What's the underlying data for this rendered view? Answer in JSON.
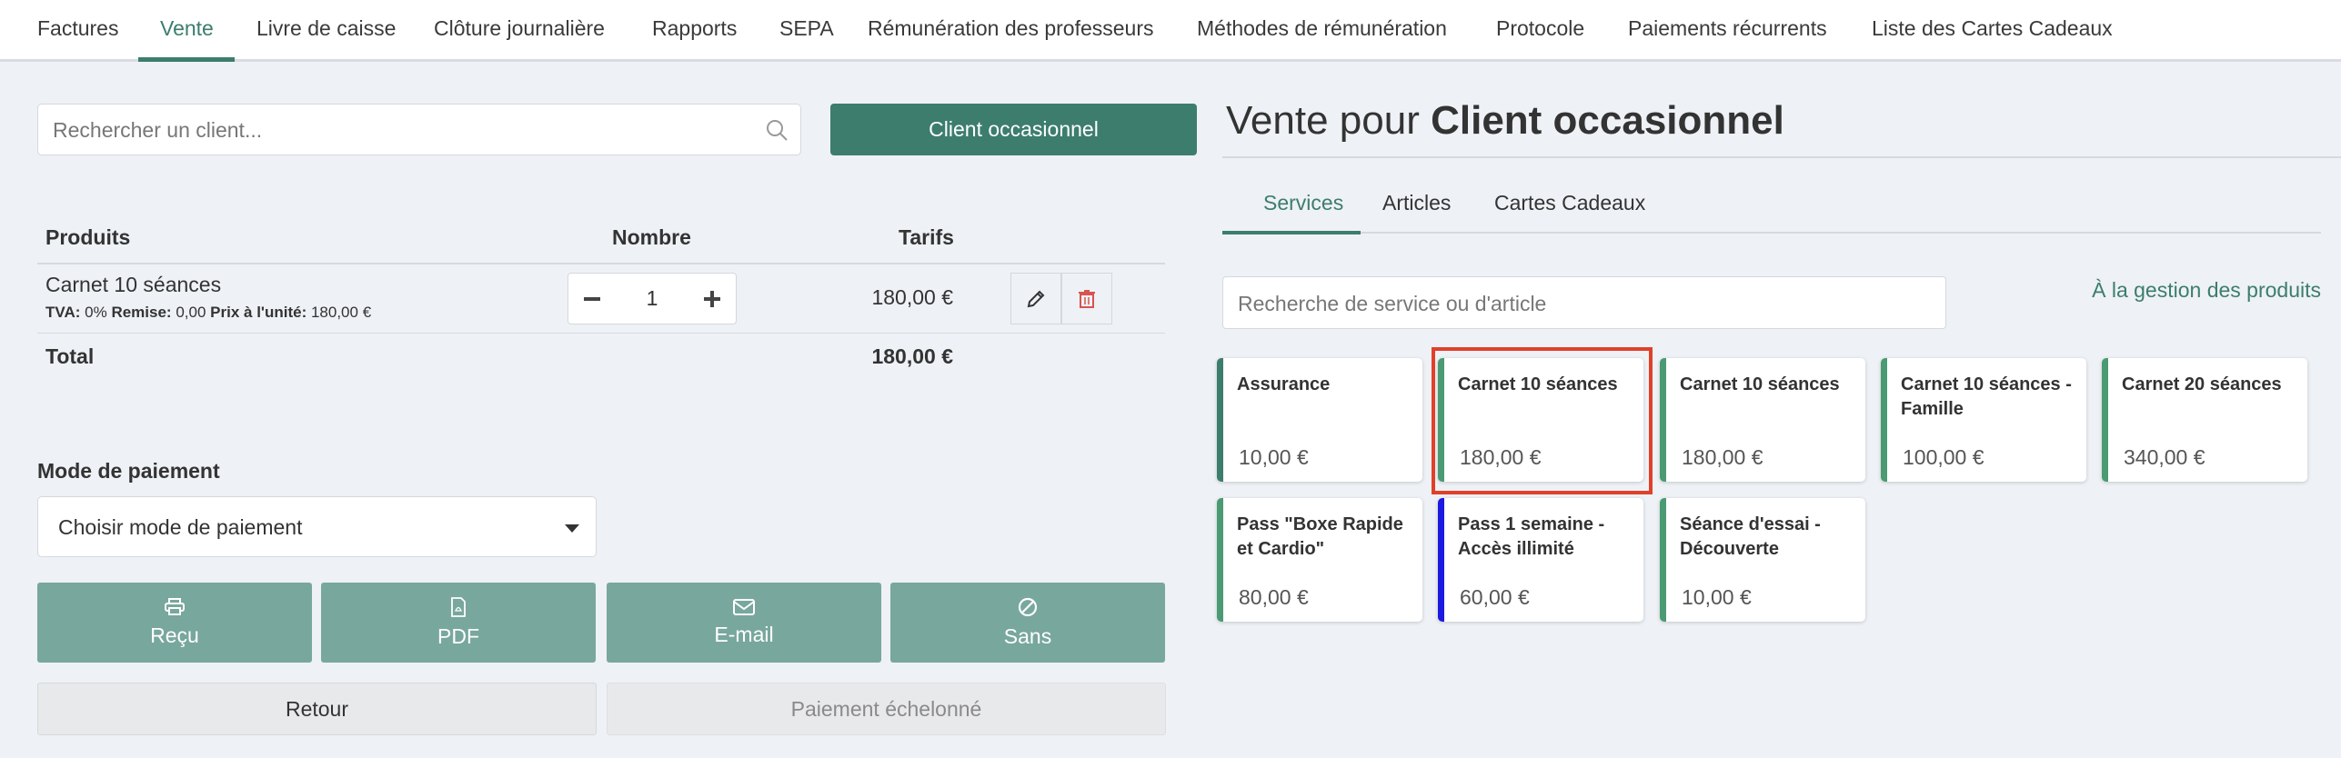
{
  "nav": {
    "tabs": [
      {
        "label": "Factures"
      },
      {
        "label": "Vente"
      },
      {
        "label": "Livre de caisse"
      },
      {
        "label": "Clôture journalière"
      },
      {
        "label": "Rapports"
      },
      {
        "label": "SEPA"
      },
      {
        "label": "Rémunération des professeurs"
      },
      {
        "label": "Méthodes de rémunération"
      },
      {
        "label": "Protocole"
      },
      {
        "label": "Paiements récurrents"
      },
      {
        "label": "Liste des Cartes Cadeaux"
      }
    ],
    "active": "Vente"
  },
  "client": {
    "search_placeholder": "Rechercher un client...",
    "occasional_button": "Client occasionnel"
  },
  "cart": {
    "headers": {
      "products": "Produits",
      "quantity": "Nombre",
      "price": "Tarifs"
    },
    "items": [
      {
        "name": "Carnet 10 séances",
        "vat_label": "TVA:",
        "vat": "0%",
        "discount_label": "Remise:",
        "discount": "0,00",
        "unit_label": "Prix à l'unité:",
        "unit_price": "180,00 €",
        "quantity": "1",
        "price": "180,00 €"
      }
    ],
    "total_label": "Total",
    "total": "180,00 €"
  },
  "payment": {
    "label": "Mode de paiement",
    "select_value": "Choisir mode de paiement",
    "actions": [
      {
        "label": "Reçu",
        "icon": "printer-icon"
      },
      {
        "label": "PDF",
        "icon": "pdf-file-icon"
      },
      {
        "label": "E-mail",
        "icon": "envelope-icon"
      },
      {
        "label": "Sans",
        "icon": "ban-icon"
      }
    ],
    "back_button": "Retour",
    "installment_button": "Paiement échelonné"
  },
  "sale": {
    "title_prefix": "Vente pour",
    "title_client": "Client occasionnel",
    "tabs": [
      {
        "label": "Services"
      },
      {
        "label": "Articles"
      },
      {
        "label": "Cartes Cadeaux"
      }
    ],
    "active_tab": "Services",
    "search_placeholder": "Recherche de service ou d'article",
    "manage_link": "À la gestion des produits",
    "products": [
      {
        "name": "Assurance",
        "price": "10,00 €",
        "color": "#3c7d6e"
      },
      {
        "name": "Carnet 10 séances",
        "price": "180,00 €",
        "color": "#4a9a73",
        "highlighted": true
      },
      {
        "name": "Carnet 10 séances",
        "price": "180,00 €",
        "color": "#4a9a73"
      },
      {
        "name": "Carnet 10 séances - Famille",
        "price": "100,00 €",
        "color": "#4a9a73"
      },
      {
        "name": "Carnet 20 séances",
        "price": "340,00 €",
        "color": "#4a9a73"
      },
      {
        "name": "Pass \"Boxe Rapide et Cardio\"",
        "price": "80,00 €",
        "color": "#4a9a73"
      },
      {
        "name": "Pass 1 semaine - Accès illimité",
        "price": "60,00 €",
        "color": "#1a1ae0"
      },
      {
        "name": "Séance d'essai - Découverte",
        "price": "10,00 €",
        "color": "#4a9a73"
      }
    ]
  },
  "colors": {
    "accent": "#3c7d6e",
    "action_button": "#78a79d",
    "highlight": "#e0402a",
    "delete": "#d9534f"
  }
}
